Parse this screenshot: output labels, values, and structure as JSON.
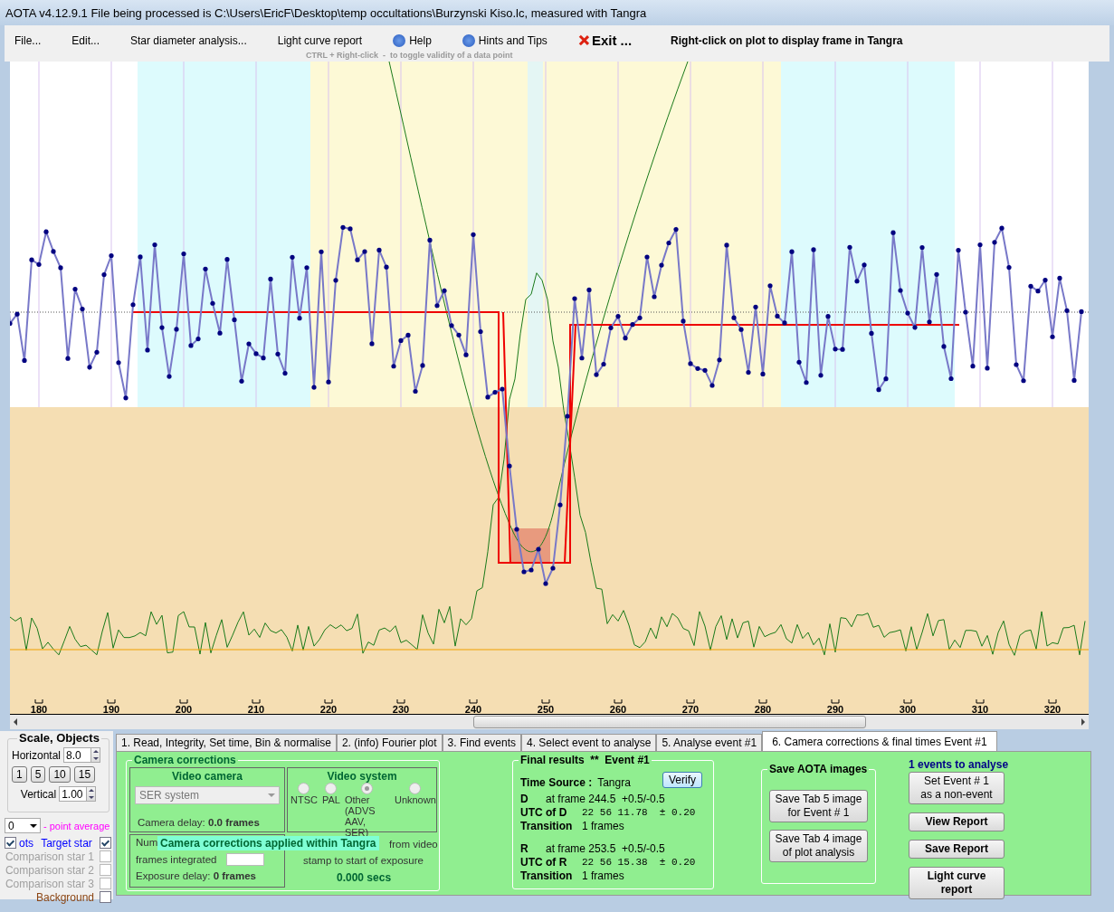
{
  "window": {
    "title": "AOTA v4.12.9.1    File being processed is C:\\Users\\EricF\\Desktop\\temp occultations\\Burzynski Kiso.lc, measured with Tangra"
  },
  "menu": [
    {
      "label": "File...",
      "kind": "plain"
    },
    {
      "label": "Edit...",
      "kind": "plain"
    },
    {
      "label": "Star diameter analysis...",
      "kind": "plain"
    },
    {
      "label": "Light curve report",
      "kind": "plain"
    },
    {
      "label": "Help",
      "kind": "help"
    },
    {
      "label": "Hints and Tips",
      "kind": "help"
    },
    {
      "label": "Exit ...",
      "kind": "exit"
    }
  ],
  "menu_hint": "Right-click on plot to display frame in Tangra",
  "plot_hint": "CTRL + Right-click  -  to toggle validity of a data point",
  "plot": {
    "x_tick_labels": [
      "180",
      "190",
      "200",
      "210",
      "220",
      "230",
      "240",
      "250",
      "260",
      "270",
      "280",
      "290",
      "300",
      "310",
      "320"
    ]
  },
  "scale": {
    "title": "Scale,  Objects",
    "horizontal_label": "Horizontal",
    "horizontal_value": "8.0",
    "step_buttons": [
      "1",
      "5",
      "10",
      "15"
    ],
    "vertical_label": "Vertical",
    "vertical_value": "1.00",
    "average_value": "0",
    "average_label": "- point average"
  },
  "left_check": {
    "label": "ots",
    "checked": true
  },
  "objects": [
    {
      "label": "Target star",
      "checked": true,
      "disabled": false,
      "color": "#0000ff"
    },
    {
      "label": "Comparison star 1",
      "checked": false,
      "disabled": true,
      "color": "#a0a0a0"
    },
    {
      "label": "Comparison star 2",
      "checked": false,
      "disabled": true,
      "color": "#a0a0a0"
    },
    {
      "label": "Comparison star 3",
      "checked": false,
      "disabled": true,
      "color": "#a0a0a0"
    },
    {
      "label": "Background",
      "checked": false,
      "disabled": false,
      "color": "#8b4513"
    }
  ],
  "tabs": [
    {
      "label": "1.  Read, Integrity, Set time, Bin & normalise",
      "selected": false
    },
    {
      "label": "2. (info)  Fourier plot",
      "selected": false
    },
    {
      "label": "3. Find events",
      "selected": false
    },
    {
      "label": "4. Select event to analyse",
      "selected": false
    },
    {
      "label": "5. Analyse event #1",
      "selected": false
    },
    {
      "label": "6. Camera corrections & final times Event #1",
      "selected": true
    }
  ],
  "camera": {
    "title": "Camera corrections",
    "video_camera": {
      "title": "Video camera",
      "dropdown": "SER system",
      "delay": "Camera delay: **0.0 frames**"
    },
    "video_system": {
      "title": "Video system",
      "radios": [
        {
          "label": "NTSC",
          "selected": false
        },
        {
          "label": "PAL",
          "selected": false
        },
        {
          "label": "Other (ADVS AAV, SER)",
          "selected": true
        },
        {
          "label": "Unknown",
          "selected": false
        }
      ]
    },
    "integration": {
      "label_1": "Num",
      "label_2": "frames integrated",
      "delay": "Exposure delay: **0 frames**"
    },
    "offset": {
      "line_1": "from video",
      "line_2": "stamp to start of exposure",
      "value": "0.000 secs"
    },
    "tooltip": "Camera corrections applied within Tangra"
  },
  "final": {
    "title": "Final results  **  Event #1",
    "verify": "Verify",
    "time_source_label": "Time Source :",
    "time_source": "Tangra",
    "events": [
      {
        "letter": "D",
        "frame": "at frame 244.5  +0.5/-0.5",
        "utc_label": "UTC of D",
        "utc": "22 56 11.78  ± 0.20",
        "transition_label": "Transition",
        "transition": "1 frames"
      },
      {
        "letter": "R",
        "frame": "at frame 253.5  +0.5/-0.5",
        "utc_label": "UTC of R",
        "utc": "22 56 15.38  ± 0.20",
        "transition_label": "Transition",
        "transition": "1 frames"
      }
    ]
  },
  "save_images": {
    "title": "Save AOTA images",
    "buttons": [
      [
        "Save Tab 5 image",
        "for Event # 1"
      ],
      [
        "Save Tab 4 image",
        "of plot analysis"
      ]
    ]
  },
  "events_panel": {
    "count": "1  events to analyse",
    "buttons": [
      {
        "lines": [
          "Set Event # 1",
          "as a non-event"
        ],
        "bold": false
      },
      {
        "lines": [
          "View Report"
        ],
        "bold": true
      },
      {
        "lines": [
          "Save Report"
        ],
        "bold": true
      },
      {
        "lines": [
          "Light curve report"
        ],
        "bold": true
      }
    ]
  }
}
